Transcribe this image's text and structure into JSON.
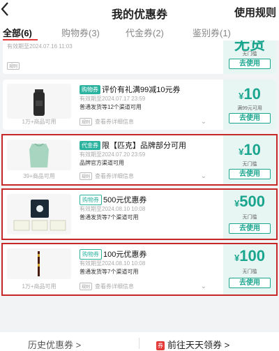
{
  "header": {
    "back_icon": "chevron-left-icon",
    "title": "我的优惠券",
    "rules": "使用规则"
  },
  "tabs": [
    {
      "label": "全部(6)",
      "active": true
    },
    {
      "label": "购物券(3)",
      "active": false
    },
    {
      "label": "代金券(2)",
      "active": false
    },
    {
      "label": "鉴别券(1)",
      "active": false
    }
  ],
  "coupons": [
    {
      "name": "",
      "badge": "",
      "validity": "有效期至2024.07.16 11:03",
      "channel": "",
      "details": "",
      "product_caption": "",
      "amount": "",
      "currency": "",
      "threshold": "无门槛",
      "use": "去使用"
    },
    {
      "badge": "购物券",
      "name": "评价有礼满99减10元券",
      "validity": "有效期至2024.07.17 23:59",
      "channel": "普通发货等12个渠道可用",
      "details": "查看券详细信息",
      "details_tag": "规则",
      "product_caption": "1万+商品可用",
      "currency": "¥",
      "amount": "10",
      "threshold": "满99元可用",
      "use": "去使用"
    },
    {
      "badge": "代金券",
      "name": "限【匹克】品牌部分可用",
      "validity": "有效期至2024.07.20 23:59",
      "channel": "品牌官方渠道可用",
      "details": "查看券详细信息",
      "details_tag": "规则",
      "product_caption": "39+商品可用",
      "currency": "¥",
      "amount": "10",
      "threshold": "无门槛",
      "use": "去使用"
    },
    {
      "badge": "购物券",
      "name": "500元优惠券",
      "validity": "有效期至2024.08.10 10:08",
      "channel": "普通发货等7个渠道可用",
      "details": "查看券详细信息",
      "details_tag": "规则",
      "product_caption": "",
      "currency": "¥",
      "amount": "500",
      "threshold": "无门槛",
      "use": "去使用"
    },
    {
      "badge": "购物券",
      "name": "100元优惠券",
      "validity": "有效期至2024.08.10 10:08",
      "channel": "普通发货等7个渠道可用",
      "details": "查看券详细信息",
      "details_tag": "规则",
      "product_caption": "1万+商品可用",
      "currency": "¥",
      "amount": "100",
      "threshold": "无门槛",
      "use": "去使用"
    }
  ],
  "bottom": {
    "history": "历史优惠券 >",
    "goto_badge": "券",
    "goto": "前往天天领券 >"
  },
  "colors": {
    "accent": "#1aa58e",
    "highlight_box": "#c62828",
    "tab_underline": "#e43a3a"
  }
}
